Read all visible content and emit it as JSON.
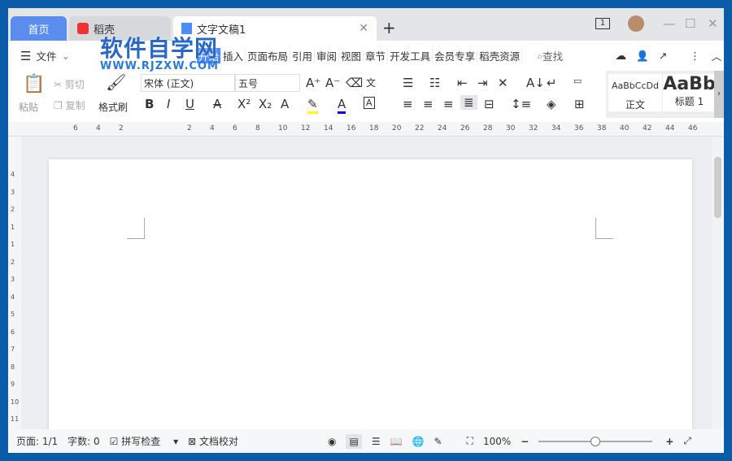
{
  "tabs": [
    {
      "label": "首页"
    },
    {
      "label": "稻壳"
    },
    {
      "label": "文字文稿1"
    }
  ],
  "window": {
    "badge": "1"
  },
  "menu": {
    "file": "文件",
    "items": [
      "开始",
      "插入",
      "页面布局",
      "引用",
      "审阅",
      "视图",
      "章节",
      "开发工具",
      "会员专享",
      "稻壳资源"
    ],
    "search": "查找"
  },
  "ribbon": {
    "paste": "粘贴",
    "cut": "剪切",
    "copy": "复制",
    "format_painter": "格式刷",
    "font": "宋体 (正文)",
    "size": "五号",
    "style_normal_preview": "AaBbCcDd",
    "style_normal": "正文",
    "style_h1_preview": "AaBb",
    "style_h1": "标题 1"
  },
  "ruler": {
    "h": [
      "6",
      "4",
      "2",
      "2",
      "4",
      "6",
      "8",
      "10",
      "12",
      "14",
      "16",
      "18",
      "20",
      "22",
      "24",
      "26",
      "28",
      "30",
      "32",
      "34",
      "36",
      "38",
      "40",
      "42",
      "44",
      "46"
    ],
    "v": [
      "4",
      "3",
      "2",
      "1",
      "1",
      "2",
      "3",
      "4",
      "5",
      "6",
      "7",
      "8",
      "9",
      "10",
      "11"
    ]
  },
  "status": {
    "page": "页面: 1/1",
    "words": "字数: 0",
    "spell": "拼写检查",
    "proof": "文档校对",
    "zoom": "100%",
    "zoom_level": 0.5
  },
  "watermark": {
    "title": "软件自学网",
    "url": "WWW.RJZXW.COM"
  }
}
